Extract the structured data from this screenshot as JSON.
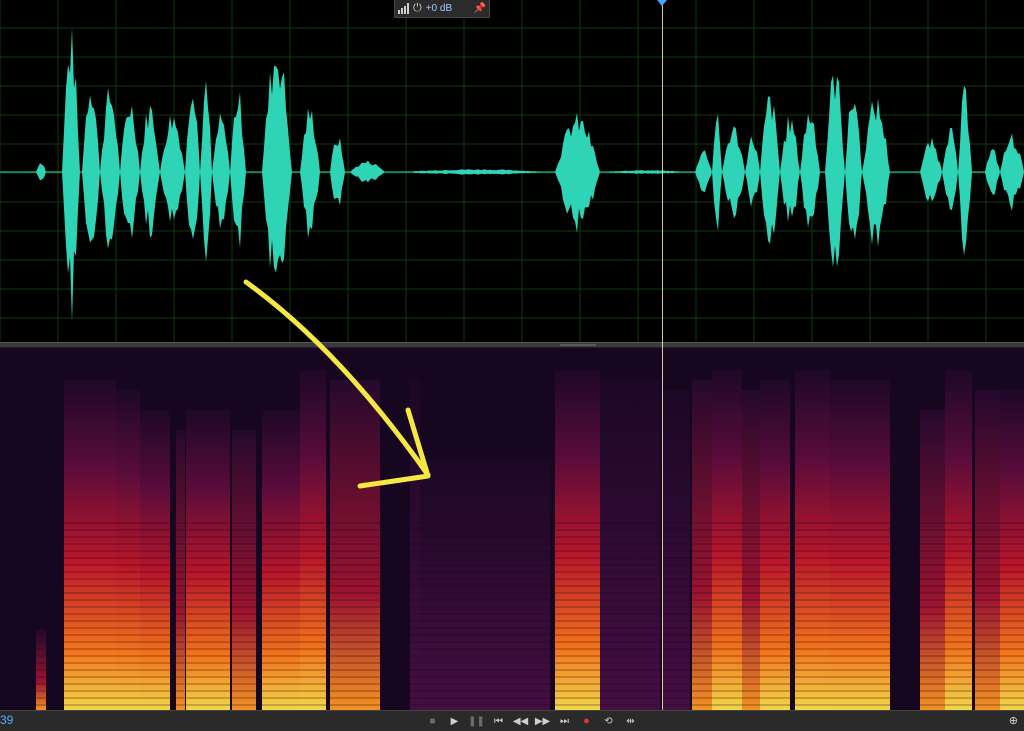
{
  "hud": {
    "level_icon": "level-meter-icon",
    "knob_icon": "gain-knob-icon",
    "gain_label": "+0 dB",
    "pin_icon": "pin-icon"
  },
  "transport": {
    "time_display": "39",
    "buttons": [
      {
        "name": "stop-button",
        "icon": "stop-icon",
        "glyph": "■"
      },
      {
        "name": "play-button",
        "icon": "play-icon",
        "glyph": "▶"
      },
      {
        "name": "pause-button",
        "icon": "pause-icon",
        "glyph": "❚❚"
      },
      {
        "name": "go-to-start-button",
        "icon": "skip-back-icon",
        "glyph": "⏮"
      },
      {
        "name": "rewind-button",
        "icon": "rewind-icon",
        "glyph": "◀◀"
      },
      {
        "name": "fast-forward-button",
        "icon": "fast-forward-icon",
        "glyph": "▶▶"
      },
      {
        "name": "go-to-end-button",
        "icon": "skip-forward-icon",
        "glyph": "⏭"
      },
      {
        "name": "record-button",
        "icon": "record-icon",
        "glyph": "●"
      },
      {
        "name": "loop-button",
        "icon": "loop-icon",
        "glyph": "⟲"
      },
      {
        "name": "skip-selection-button",
        "icon": "skip-selection-icon",
        "glyph": "⇹"
      }
    ],
    "zoom_icon": "zoom-icon"
  },
  "colors": {
    "waveform": "#2fd3b6",
    "grid": "#123d12",
    "playhead": "#e9e3a3",
    "annotation_arrow": "#f5e842",
    "spectrogram_low": "#16061f",
    "spectrogram_high": "#ffe24a"
  }
}
